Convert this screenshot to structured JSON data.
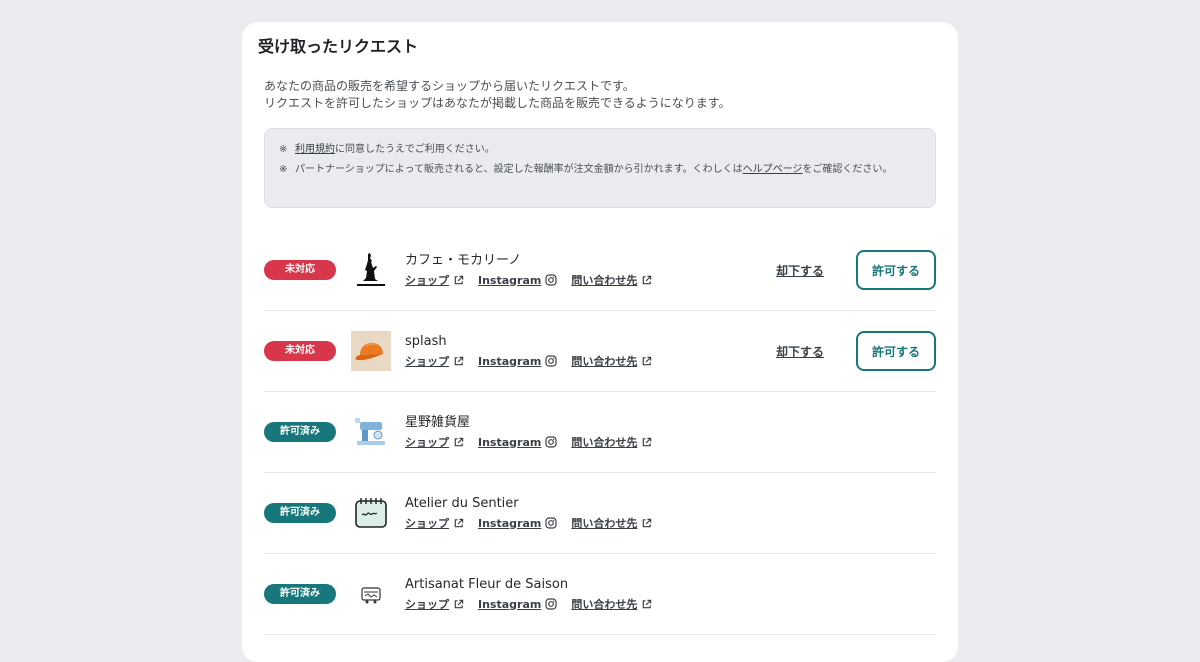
{
  "page": {
    "title": "受け取ったリクエスト",
    "description": [
      "あなたの商品の販売を希望するショップから届いたリクエストです。",
      "リクエストを許可したショップはあなたが掲載した商品を販売できるようになります。"
    ]
  },
  "notice": {
    "mark": "※",
    "note1": {
      "link": "利用規約",
      "text": "に同意したうえでご利用ください。"
    },
    "note2": {
      "text_before": "パートナーショップによって販売されると、設定した報酬率が注文金額から引かれます。くわしくは",
      "link": "ヘルプページ",
      "text_after": "をご確認ください。"
    }
  },
  "row_labels": {
    "shop": "ショップ",
    "instagram": "Instagram",
    "contact": "問い合わせ先",
    "reject": "却下する",
    "approve": "許可する"
  },
  "requests": [
    {
      "status": "未対応",
      "status_type": "pending",
      "name": "カフェ・モカリーノ",
      "avatar_icon": "silhouette-statue-icon"
    },
    {
      "status": "未対応",
      "status_type": "pending",
      "name": "splash",
      "avatar_icon": "orange-cap-icon"
    },
    {
      "status": "許可済み",
      "status_type": "approved",
      "name": "星野雑貨屋",
      "avatar_icon": "sewing-machine-icon"
    },
    {
      "status": "許可済み",
      "status_type": "approved",
      "name": "Atelier du Sentier",
      "avatar_icon": "notepad-icon"
    },
    {
      "status": "許可済み",
      "status_type": "approved",
      "name": "Artisanat Fleur de Saison",
      "avatar_icon": "sketch-doodle-icon"
    }
  ],
  "colors": {
    "pending": "#d8364a",
    "approved": "#17777a",
    "background": "#ebecf0"
  }
}
